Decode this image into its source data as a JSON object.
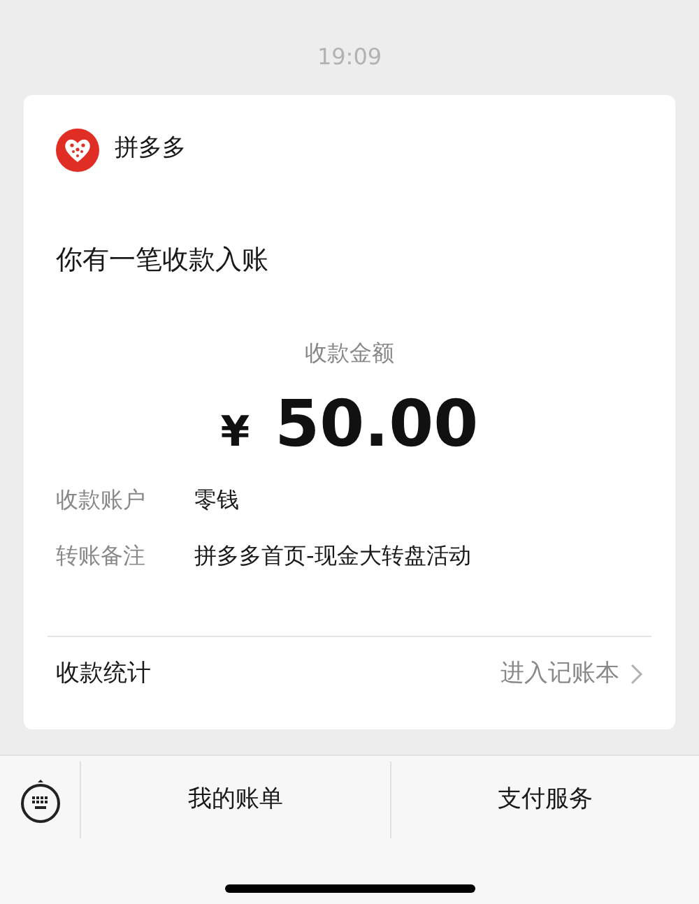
{
  "time": "19:09",
  "card": {
    "sender": "拼多多",
    "title": "你有一笔收款入账",
    "amount_label": "收款金额",
    "currency": "¥",
    "amount": "50.00",
    "details": [
      {
        "label": "收款账户",
        "value": "零钱"
      },
      {
        "label": "转账备注",
        "value": "拼多多首页-现金大转盘活动"
      }
    ],
    "footer": {
      "label": "收款统计",
      "link": "进入记账本"
    }
  },
  "bottom_bar": {
    "menus": [
      "我的账单",
      "支付服务"
    ]
  }
}
